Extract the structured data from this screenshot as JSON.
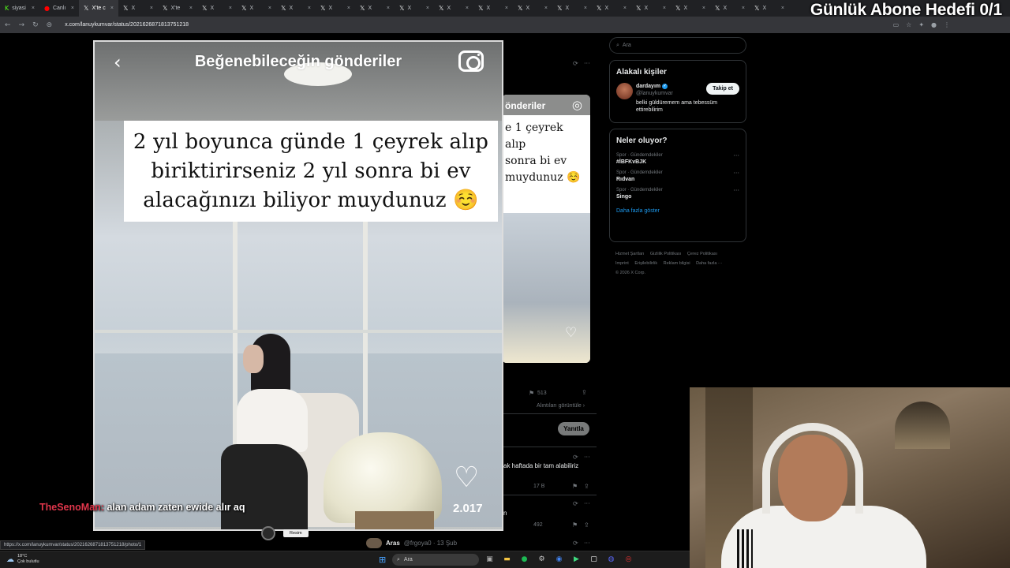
{
  "browser": {
    "tabs": [
      {
        "label": "siyasi",
        "icon": "k-icon"
      },
      {
        "label": "Canlı",
        "icon": "red-record-icon"
      },
      {
        "label": "X'te c",
        "icon": "x-icon"
      },
      {
        "label": "X",
        "icon": "x-icon"
      },
      {
        "label": "X'te",
        "icon": "x-icon"
      },
      {
        "label": "X",
        "icon": "x-icon"
      },
      {
        "label": "X",
        "icon": "x-icon"
      },
      {
        "label": "X",
        "icon": "x-icon"
      },
      {
        "label": "X",
        "icon": "x-icon"
      },
      {
        "label": "X",
        "icon": "x-icon"
      },
      {
        "label": "X",
        "icon": "x-icon"
      },
      {
        "label": "X",
        "icon": "x-icon"
      },
      {
        "label": "X",
        "icon": "x-icon"
      },
      {
        "label": "X",
        "icon": "x-icon"
      },
      {
        "label": "X",
        "icon": "x-icon"
      },
      {
        "label": "X",
        "icon": "x-icon"
      },
      {
        "label": "X",
        "icon": "x-icon"
      },
      {
        "label": "X",
        "icon": "x-icon"
      },
      {
        "label": "X",
        "icon": "x-icon"
      },
      {
        "label": "X",
        "icon": "x-icon"
      }
    ],
    "active_tab": 2,
    "url": "x.com/lanuykumvar/status/2021626871813751218",
    "status_url": "https://x.com/lanuykumvar/status/2021626871813751218/photo/1"
  },
  "stream_overlay": {
    "goal_text": "Günlük Abone Hedefi 0/1",
    "caption_user": "TheSenoMan:",
    "caption_text": "alan adam zaten ewide alır aq"
  },
  "viewer": {
    "header_title": "Beğenebileceğin gönderiler",
    "quote_lines": [
      "2 yıl boyunca günde 1 çeyrek alıp",
      "biriktirirseniz 2 yıl sonra bi ev",
      "alacağınızı biliyor muydunuz ☺️"
    ],
    "likes": "2.017",
    "resim_label": "Resim"
  },
  "background_post": {
    "header_fragment": "önderiler",
    "text_lines": [
      "e 1 çeyrek alıp",
      "sonra bi ev",
      "muydunuz ☺️"
    ],
    "bookmark_count": "513",
    "quotes_link": "Alıntıları görüntüle ›",
    "reply_button": "Yanıtla",
    "reply_text": "ak haftada bir tam alabiliriz",
    "reply_count_1": "17 B",
    "reply_count_2": "492",
    "reply2_fragment": "n",
    "bottom_user_name": "Aras",
    "bottom_user_handle": "@frgoya0 · 13 Şub"
  },
  "sidebar": {
    "search_placeholder": "Ara",
    "related_title": "Alakalı kişiler",
    "person": {
      "name": "dardayım",
      "handle": "@lanuykumvar",
      "bio_line1": "belki güldüremem ama tebessüm",
      "bio_line2": "ettirebilirim",
      "follow_label": "Takip et"
    },
    "trends_title": "Neler oluyor?",
    "trends": [
      {
        "category": "Spor · Gündemdekiler",
        "name": "#İBFKvBJK"
      },
      {
        "category": "Spor · Gündemdekiler",
        "name": "Rıdvan"
      },
      {
        "category": "Spor · Gündemdekiler",
        "name": "Singo"
      }
    ],
    "show_more": "Daha fazla göster",
    "footer_line1": [
      "Hizmet Şartları",
      "Gizlilik Politikası",
      "Çerez Politikası"
    ],
    "footer_line2": [
      "Imprint",
      "Erişilebilirlik",
      "Reklam bilgisi",
      "Daha fazla ···"
    ],
    "copyright": "© 2026 X Corp."
  },
  "taskbar": {
    "temperature": "18°C",
    "weather_desc": "Çok bulutlu",
    "search_placeholder": "Ara"
  }
}
